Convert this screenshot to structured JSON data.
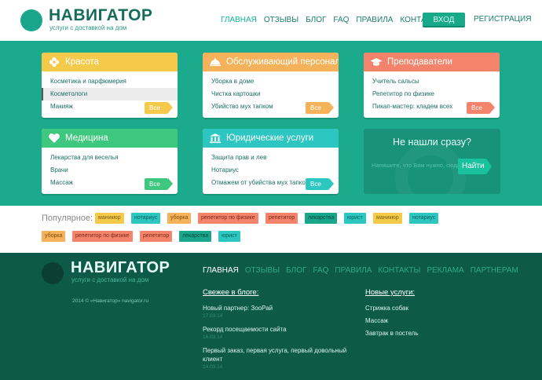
{
  "header": {
    "logo_title": "НАВИГАТОР",
    "logo_subtitle": "услуги с доставкой на дом",
    "nav": [
      "ГЛАВНАЯ",
      "ОТЗЫВЫ",
      "БЛОГ",
      "FAQ",
      "ПРАВИЛА",
      "КОНТАКТЫ"
    ],
    "login_label": "ВХОД",
    "register_label": "РЕГИСТРАЦИЯ"
  },
  "categories": [
    {
      "title": "Красота",
      "icon": "flower-icon",
      "color": "#f5c94a",
      "items": [
        "Косметика и парфюмерия",
        "Косметологи",
        "Макияж"
      ],
      "all": "Все"
    },
    {
      "title": "Обслуживающий персонал",
      "icon": "food-cloche-icon",
      "color": "#f6b25a",
      "items": [
        "Уборка в доме",
        "Чистка картошки",
        "Убийство мух тапком"
      ],
      "all": "Все"
    },
    {
      "title": "Преподаватели",
      "icon": "graduation-cap-icon",
      "color": "#f3836a",
      "items": [
        "Учитель сальсы",
        "Репетитор по физике",
        "Пикап-мастер: кладем всех"
      ],
      "all": "Все"
    },
    {
      "title": "Медицина",
      "icon": "heart-icon",
      "color": "#3ec77e",
      "items": [
        "Лекарства для веселья",
        "Врачи",
        "Массаж"
      ],
      "all": "Все"
    },
    {
      "title": "Юридические услуги",
      "icon": "courthouse-icon",
      "color": "#2ec6c0",
      "items": [
        "Защита прав и лев",
        "Нотариус",
        "Отмажем от убийства мух тапком"
      ],
      "all": "Все"
    }
  ],
  "not_found": {
    "title": "Не нашли сразу?",
    "placeholder": "Напишите, что Вам нужно, сюда",
    "button": "Найти"
  },
  "popular": {
    "label": "Популярное:",
    "tags": [
      {
        "text": "маникюр",
        "bg": "#f5c94a",
        "fg": "#7a5d10"
      },
      {
        "text": "нотариус",
        "bg": "#2ec6c0",
        "fg": "#0b5f5b"
      },
      {
        "text": "уборка",
        "bg": "#f6b25a",
        "fg": "#7a4b10"
      },
      {
        "text": "репетитор по физике",
        "bg": "#f3836a",
        "fg": "#7a2a18"
      },
      {
        "text": "репетитор",
        "bg": "#f3836a",
        "fg": "#7a2a18"
      },
      {
        "text": "лекарства",
        "bg": "#1aa68a",
        "fg": "#0b4a3c"
      },
      {
        "text": "юрист",
        "bg": "#2ec6c0",
        "fg": "#0b5f5b"
      },
      {
        "text": "маникюр",
        "bg": "#f5c94a",
        "fg": "#7a5d10"
      },
      {
        "text": "нотариус",
        "bg": "#2ec6c0",
        "fg": "#0b5f5b"
      },
      {
        "text": "уборка",
        "bg": "#f6b25a",
        "fg": "#7a4b10"
      },
      {
        "text": "репетитор по физике",
        "bg": "#f3836a",
        "fg": "#7a2a18"
      },
      {
        "text": "репетитор",
        "bg": "#f3836a",
        "fg": "#7a2a18"
      },
      {
        "text": "лекарства",
        "bg": "#1aa68a",
        "fg": "#0b4a3c"
      },
      {
        "text": "юрист",
        "bg": "#2ec6c0",
        "fg": "#0b5f5b"
      }
    ]
  },
  "footer": {
    "logo_title": "НАВИГАТОР",
    "logo_subtitle": "услуги с доставкой на дом",
    "copyright": "2014 © «Навигатор» navigator.ru",
    "nav": [
      "ГЛАВНАЯ",
      "ОТЗЫВЫ",
      "БЛОГ",
      "FAQ",
      "ПРАВИЛА",
      "КОНТАКТЫ",
      "РЕКЛАМА",
      "ПАРТНЕРАМ"
    ],
    "blog_title": "Свежее в блоге:",
    "blog": [
      {
        "text": "Новый партнер: ЗооРай",
        "date": "17.03.14"
      },
      {
        "text": "Рекорд посещаемости сайта",
        "date": "16.03.14"
      },
      {
        "text": "Первый заказ, первая услуга, первый довольный клиент",
        "line1": "Первый заказ, первая услуга, первый довольный",
        "line2": "клиент",
        "date": "14.03.14"
      }
    ],
    "services_title": "Новые услуги:",
    "services": [
      "Стрижка собак",
      "Массаж",
      "Завтрак в постель"
    ]
  }
}
